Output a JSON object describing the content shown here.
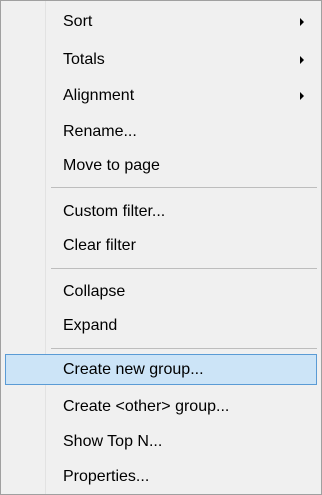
{
  "context_menu": {
    "items": [
      {
        "label": "Sort",
        "has_submenu": true
      },
      {
        "label": "Totals",
        "has_submenu": true
      },
      {
        "label": "Alignment",
        "has_submenu": true
      },
      {
        "label": "Rename..."
      },
      {
        "label": "Move to page"
      },
      {
        "label": "Custom filter..."
      },
      {
        "label": "Clear filter"
      },
      {
        "label": "Collapse"
      },
      {
        "label": "Expand"
      },
      {
        "label": "Create new group...",
        "selected": true
      },
      {
        "label": "Create <other> group..."
      },
      {
        "label": "Show Top N..."
      },
      {
        "label": "Properties..."
      }
    ],
    "colors": {
      "background": "#f0f0f0",
      "highlight": "#cce4f7",
      "highlight_border": "#5a9bd5",
      "separator": "#bdbdbd",
      "text": "#000000"
    },
    "icons": {
      "submenu_indicator": "chevron-right-icon"
    }
  }
}
